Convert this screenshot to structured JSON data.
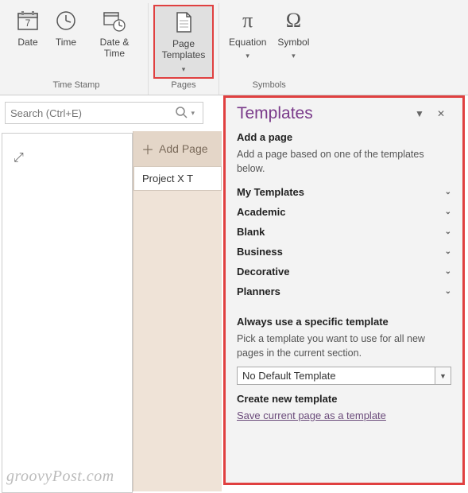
{
  "ribbon": {
    "groups": [
      {
        "label": "Time Stamp",
        "buttons": [
          {
            "label": "Date",
            "icon": "date"
          },
          {
            "label": "Time",
            "icon": "time"
          },
          {
            "label": "Date & Time",
            "icon": "datetime"
          }
        ]
      },
      {
        "label": "Pages",
        "buttons": [
          {
            "label": "Page Templates",
            "icon": "page",
            "dropdown": true,
            "highlighted": true
          }
        ]
      },
      {
        "label": "Symbols",
        "buttons": [
          {
            "label": "Equation",
            "icon": "equation",
            "dropdown": true
          },
          {
            "label": "Symbol",
            "icon": "symbol",
            "dropdown": true
          }
        ]
      }
    ]
  },
  "search": {
    "placeholder": "Search (Ctrl+E)"
  },
  "pagelist": {
    "add_label": "Add Page",
    "items": [
      "Project X T"
    ]
  },
  "templates": {
    "title": "Templates",
    "add_page_title": "Add a page",
    "add_page_desc": "Add a page based on one of the templates below.",
    "categories": [
      "My Templates",
      "Academic",
      "Blank",
      "Business",
      "Decorative",
      "Planners"
    ],
    "always_title": "Always use a specific template",
    "always_desc": "Pick a template you want to use for all new pages in the current section.",
    "default_value": "No Default Template",
    "create_title": "Create new template",
    "save_link": "Save current page as a template"
  },
  "watermark": "groovyPost.com"
}
